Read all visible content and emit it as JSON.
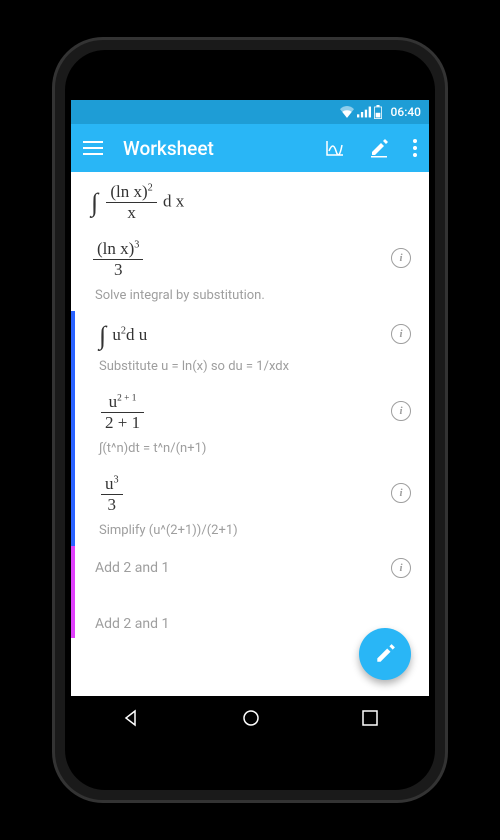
{
  "status": {
    "time": "06:40"
  },
  "appbar": {
    "title": "Worksheet"
  },
  "content": {
    "row1_caption_none": "",
    "solve_caption": "Solve integral by substitution.",
    "subst_caption": "Substitute u = ln(x) so du = 1/xdx",
    "power_rule_caption": "∫(t^n)dt = t^n/(n+1)",
    "simplify_caption": "Simplify (u^(2+1))/(2+1)",
    "add_caption_1": "Add 2 and 1",
    "add_caption_2": "Add 2 and 1",
    "expr": {
      "lnx": "(ln x)",
      "x": "x",
      "dx": "d x",
      "three": "3",
      "u": "u",
      "du": "d u",
      "two": "2",
      "twoplus1": "2 + 1",
      "twoplus1_sup": "2 + 1"
    }
  },
  "icons": {
    "info": "i"
  }
}
